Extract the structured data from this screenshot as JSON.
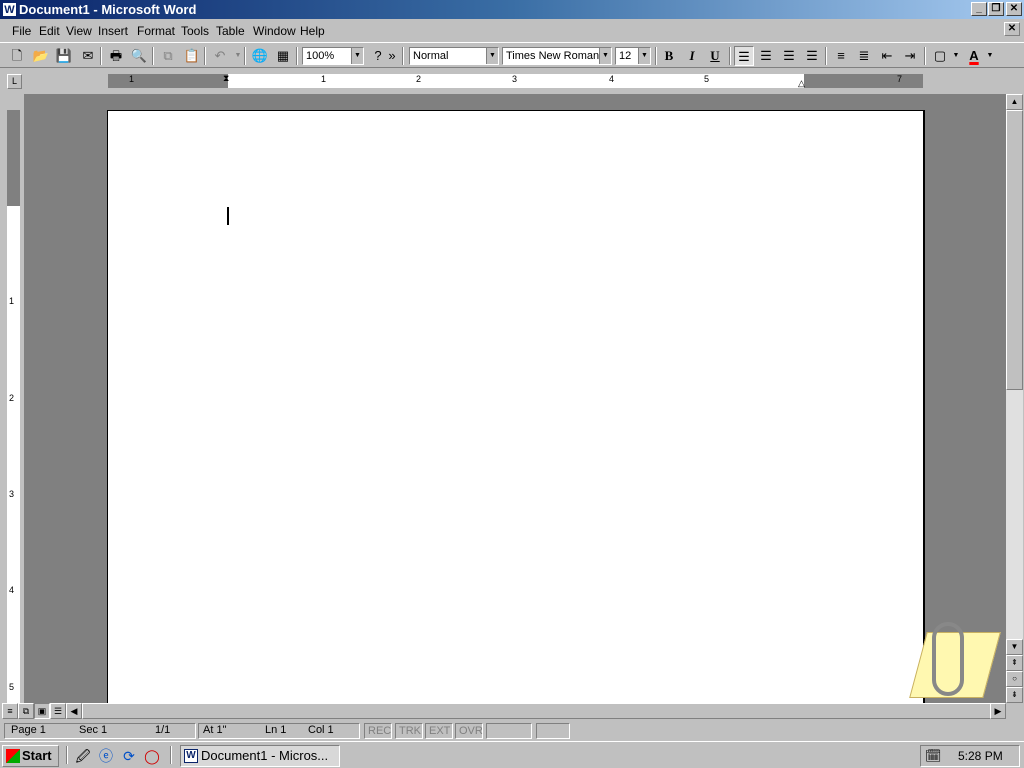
{
  "window": {
    "title": "Document1 - Microsoft Word",
    "app_icon": "W",
    "minimize_glyph": "_",
    "restore_glyph": "❐",
    "close_glyph": "✕"
  },
  "menubar": {
    "items": [
      "File",
      "Edit",
      "View",
      "Insert",
      "Format",
      "Tools",
      "Table",
      "Window",
      "Help"
    ],
    "doc_close_glyph": "✕"
  },
  "toolbar": {
    "zoom": "100%",
    "style": "Normal",
    "font": "Times New Roman",
    "size": "12",
    "bold": "B",
    "italic": "I",
    "underline": "U",
    "help": "?",
    "more": "»",
    "font_color": "A",
    "accent_color": "#ff0000"
  },
  "ruler": {
    "tab_selector": "L",
    "numbers": [
      "1",
      "1",
      "2",
      "3",
      "4",
      "5",
      "7"
    ]
  },
  "vruler": {
    "numbers": [
      "1",
      "2",
      "3",
      "4",
      "5"
    ]
  },
  "statusbar": {
    "page": "Page 1",
    "sec": "Sec 1",
    "pages": "1/1",
    "at": "At 1\"",
    "ln": "Ln 1",
    "col": "Col 1",
    "rec": "REC",
    "trk": "TRK",
    "ext": "EXT",
    "ovr": "OVR"
  },
  "taskbar": {
    "start": "Start",
    "task_doc": "Document1 - Micros...",
    "clock": "5:28 PM"
  },
  "icons": {
    "new": "new-document-icon",
    "open": "open-folder-icon",
    "save": "save-disk-icon",
    "print": "print-icon",
    "preview": "print-preview-icon"
  }
}
